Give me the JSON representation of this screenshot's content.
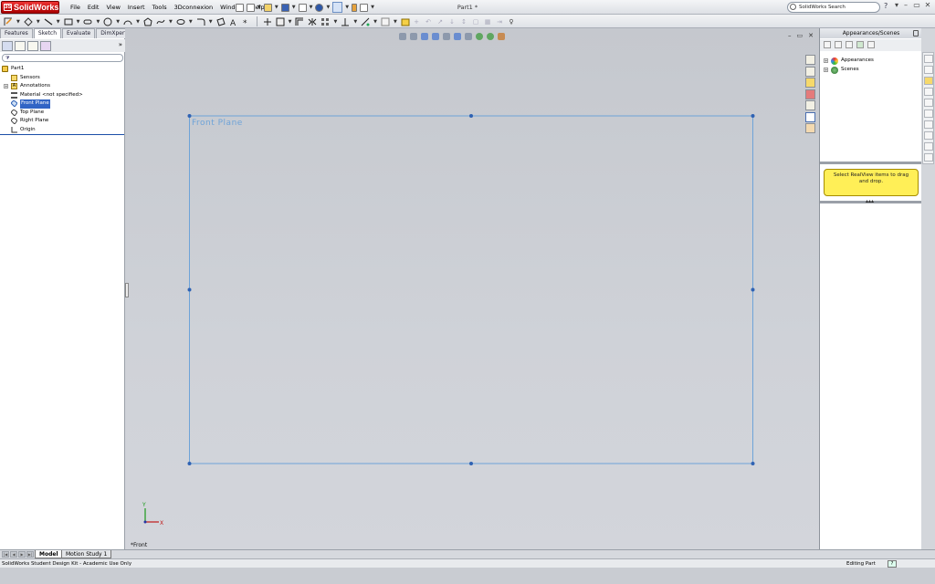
{
  "app": {
    "logo_text": "SolidWorks",
    "document_title": "Part1 *",
    "menu": [
      "File",
      "Edit",
      "View",
      "Insert",
      "Tools",
      "3Dconnexion",
      "Window",
      "Help"
    ],
    "search_placeholder": "SolidWorks Search",
    "help_glyph": "?"
  },
  "command_manager": {
    "tabs": [
      "Features",
      "Sketch",
      "Evaluate",
      "DimXpert"
    ],
    "active_tab": "Sketch"
  },
  "feature_tree": {
    "filter_glyph": "⧩",
    "items": [
      {
        "label": "Part1",
        "icon": "part-icon"
      },
      {
        "label": "Sensors",
        "icon": "sensors-icon"
      },
      {
        "label": "Annotations",
        "icon": "annotations-icon"
      },
      {
        "label": "Material <not specified>",
        "icon": "material-icon"
      },
      {
        "label": "Front Plane",
        "icon": "plane-icon",
        "selected": true
      },
      {
        "label": "Top Plane",
        "icon": "plane-icon"
      },
      {
        "label": "Right Plane",
        "icon": "plane-icon"
      },
      {
        "label": "Origin",
        "icon": "origin-icon"
      }
    ]
  },
  "graphics": {
    "plane_label": "Front Plane",
    "view_label": "*Front",
    "triad_x": "X",
    "triad_y": "Y",
    "plane_color": "#6ea3d8",
    "handle_color": "#2f62b3"
  },
  "task_pane": {
    "title": "Appearances/Scenes",
    "items": [
      {
        "label": "Appearances",
        "icon": "appearances-icon"
      },
      {
        "label": "Scenes",
        "icon": "scenes-icon"
      }
    ],
    "hint": "Select RealView items to drag and drop.",
    "splitter_glyph": "▴▴▴"
  },
  "bottom_tabs": [
    "Model",
    "Motion Study 1"
  ],
  "status": {
    "left": "SolidWorks Student Design Kit - Academic Use Only",
    "right": "Editing Part",
    "help_glyph": "?"
  },
  "colors": {
    "selection": "#3164c5",
    "hint_bg": "#ffef57",
    "logo_red": "#cc1111"
  }
}
